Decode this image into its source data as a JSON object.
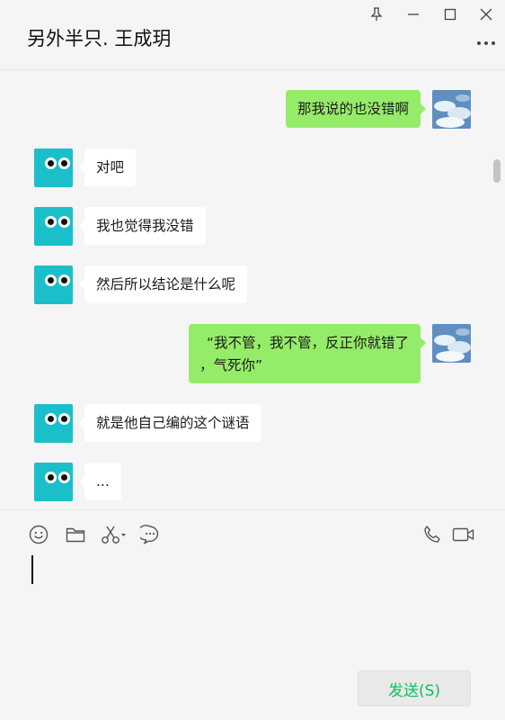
{
  "window": {
    "title": "另外半只. 王成玥",
    "controls": [
      "pin-icon",
      "minimize-icon",
      "maximize-icon",
      "close-icon"
    ]
  },
  "messages": [
    {
      "sender": "me",
      "text": "那我说的也没错啊"
    },
    {
      "sender": "other",
      "text": "对吧"
    },
    {
      "sender": "other",
      "text": "我也觉得我没错"
    },
    {
      "sender": "other",
      "text": "然后所以结论是什么呢"
    },
    {
      "sender": "me",
      "line1": "“我不管，我不管，反正你就错了",
      "line2": "，气死你”"
    },
    {
      "sender": "other",
      "text": "就是他自己编的这个谜语"
    },
    {
      "sender": "other",
      "text": "..."
    }
  ],
  "toolbar": {
    "left_icons": [
      "emoji-icon",
      "folder-icon",
      "scissors-icon",
      "chat-bubble-icon"
    ],
    "right_icons": [
      "phone-icon",
      "video-icon"
    ]
  },
  "composer": {
    "input_value": "",
    "send_label": "发送(S)"
  },
  "colors": {
    "background": "#f5f5f5",
    "my_bubble": "#95ec69",
    "their_bubble": "#ffffff",
    "bot_avatar": "#1bbfca",
    "send_text": "#07c160"
  }
}
